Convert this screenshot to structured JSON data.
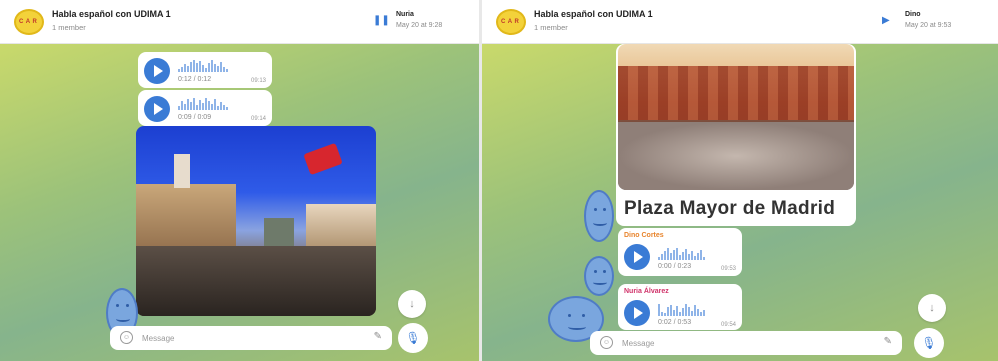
{
  "left": {
    "header": {
      "title": "Habla español con UDIMA 1",
      "subtitle": "1 member",
      "now_playing_name": "Nuria",
      "now_playing_date": "May 20 at 9:28",
      "play_icon": "pause-icon"
    },
    "voice_messages": [
      {
        "duration": "0:12 / 0:12",
        "time": "09:13"
      },
      {
        "duration": "0:09 / 0:09",
        "time": "09:14"
      }
    ],
    "composer": {
      "placeholder": "Message"
    }
  },
  "right": {
    "header": {
      "title": "Habla español con UDIMA 1",
      "subtitle": "1 member",
      "now_playing_name": "Dino",
      "now_playing_date": "May 20 at 9:53",
      "play_icon": "play-icon"
    },
    "photo_caption": "Plaza Mayor de Madrid",
    "voice_messages": [
      {
        "sender": "Dino Cortes",
        "sender_color": "#e8842c",
        "duration": "0:00 / 0:23",
        "time": "09:53"
      },
      {
        "sender": "Nuria Álvarez",
        "sender_color": "#d0336a",
        "duration": "0:02 / 0:53",
        "time": "09:54"
      }
    ],
    "composer": {
      "placeholder": "Message"
    }
  },
  "colors": {
    "accent": "#3a7bd5",
    "smiley": "#7aa6de"
  }
}
